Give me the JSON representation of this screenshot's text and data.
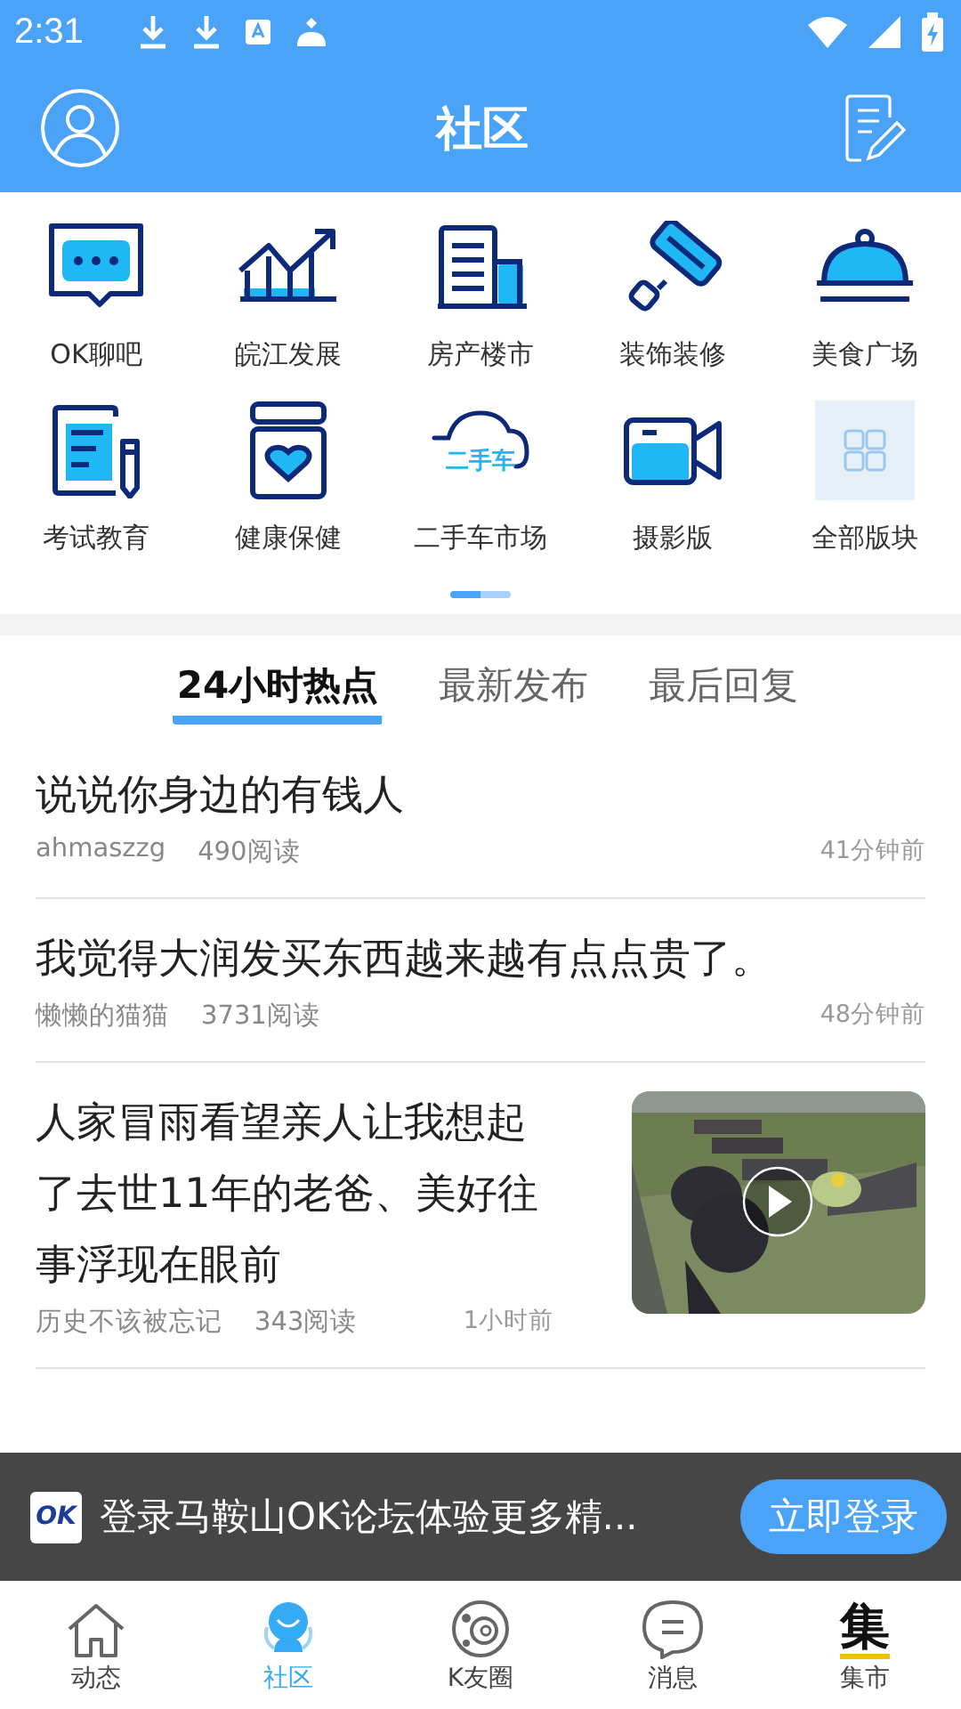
{
  "status_bar": {
    "time": "2:31"
  },
  "header": {
    "title": "社区"
  },
  "categories": [
    {
      "label": "OK聊吧",
      "kind": "chat"
    },
    {
      "label": "皖江发展",
      "kind": "chart"
    },
    {
      "label": "房产楼市",
      "kind": "building"
    },
    {
      "label": "装饰装修",
      "kind": "roller"
    },
    {
      "label": "美食广场",
      "kind": "cloche"
    },
    {
      "label": "考试教育",
      "kind": "exam"
    },
    {
      "label": "健康保健",
      "kind": "jar"
    },
    {
      "label": "二手车市场",
      "kind": "cloud",
      "icon_text": "二手车"
    },
    {
      "label": "摄影版",
      "kind": "camera"
    },
    {
      "label": "全部版块",
      "kind": "grid"
    }
  ],
  "pager": [
    {
      "selected": true
    },
    {
      "selected": false
    }
  ],
  "tabs": [
    {
      "label": "24小时热点",
      "selected": true
    },
    {
      "label": "最新发布",
      "selected": false
    },
    {
      "label": "最后回复",
      "selected": false
    }
  ],
  "posts": [
    {
      "title": "说说你身边的有钱人",
      "author": "ahmaszzg",
      "reads": "490阅读",
      "time": "41分钟前"
    },
    {
      "title": "我觉得大润发买东西越来越有点点贵了。",
      "author": "懒懒的猫猫",
      "reads": "3731阅读",
      "time": "48分钟前"
    },
    {
      "title": "人家冒雨看望亲人让我想起了去世11年的老爸、美好往事浮现在眼前",
      "author": "历史不该被忘记",
      "reads": "343阅读",
      "time": "1小时前",
      "thumbnail": {
        "kind": "picture",
        "video": true
      }
    }
  ],
  "login_banner": {
    "logo_text": "OK",
    "message": "登录马鞍山OK论坛体验更多精...",
    "button": "立即登录"
  },
  "bottom_nav": [
    {
      "label": "动态",
      "kind": "home",
      "selected": false
    },
    {
      "label": "社区",
      "kind": "person",
      "selected": true
    },
    {
      "label": "K友圈",
      "kind": "planet",
      "selected": false
    },
    {
      "label": "消息",
      "kind": "message",
      "selected": false
    },
    {
      "label": "集市",
      "kind": "glyph",
      "icon_text": "集",
      "selected": false
    }
  ]
}
